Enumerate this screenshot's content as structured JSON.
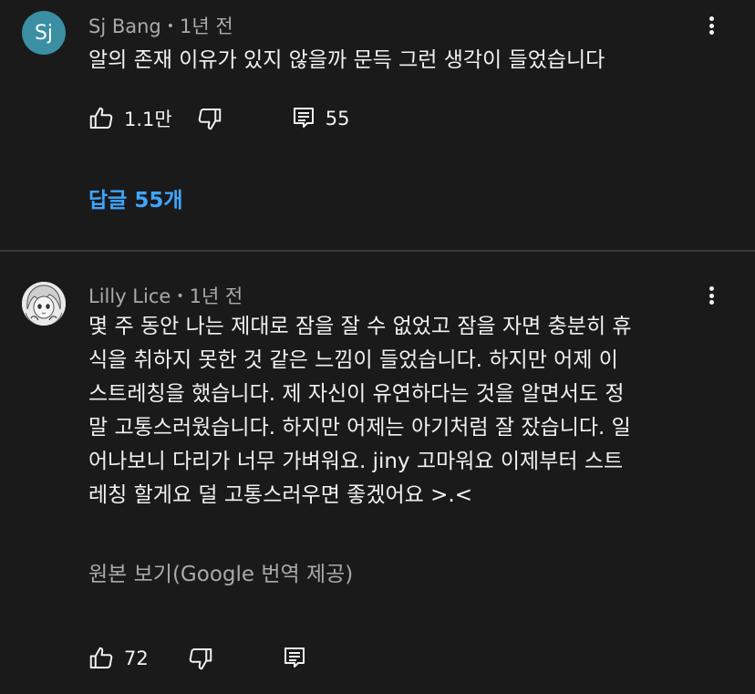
{
  "comments": [
    {
      "avatar_text": "Sj",
      "author": "Sj Bang",
      "time": "1년 전",
      "text": "알의 존재 이유가 있지 않을까 문득 그런 생각이 들었습니다",
      "likes": "1.1만",
      "reply_count": "55",
      "replies_link": "답글 55개"
    },
    {
      "author": "Lilly Lice",
      "time": "1년 전",
      "text": "몇 주 동안 나는 제대로 잠을 잘 수 없었고 잠을 자면 충분히 휴\n식을 취하지 못한 것 같은 느낌이 들었습니다. 하지만 어제 이\n스트레칭을 했습니다. 제 자신이 유연하다는 것을 알면서도 정\n말 고통스러웠습니다. 하지만 어제는 아기처럼 잘 잤습니다. 일\n어나보니 다리가 너무 가벼워요. jiny 고마워요 이제부터 스트\n레칭 할게요 덜 고통스러우면 좋겠어요 >.<",
      "translate_label": "원본 보기(Google 번역 제공)",
      "likes": "72"
    }
  ],
  "icons": {
    "like": "thumbs-up-icon",
    "dislike": "thumbs-down-icon",
    "reply": "comment-icon",
    "more": "more-vert-icon"
  },
  "colors": {
    "background": "#1a1a1a",
    "link": "#3ea6ff",
    "secondary_text": "#aaaaaa",
    "avatar_sj": "#3b8fa3"
  }
}
